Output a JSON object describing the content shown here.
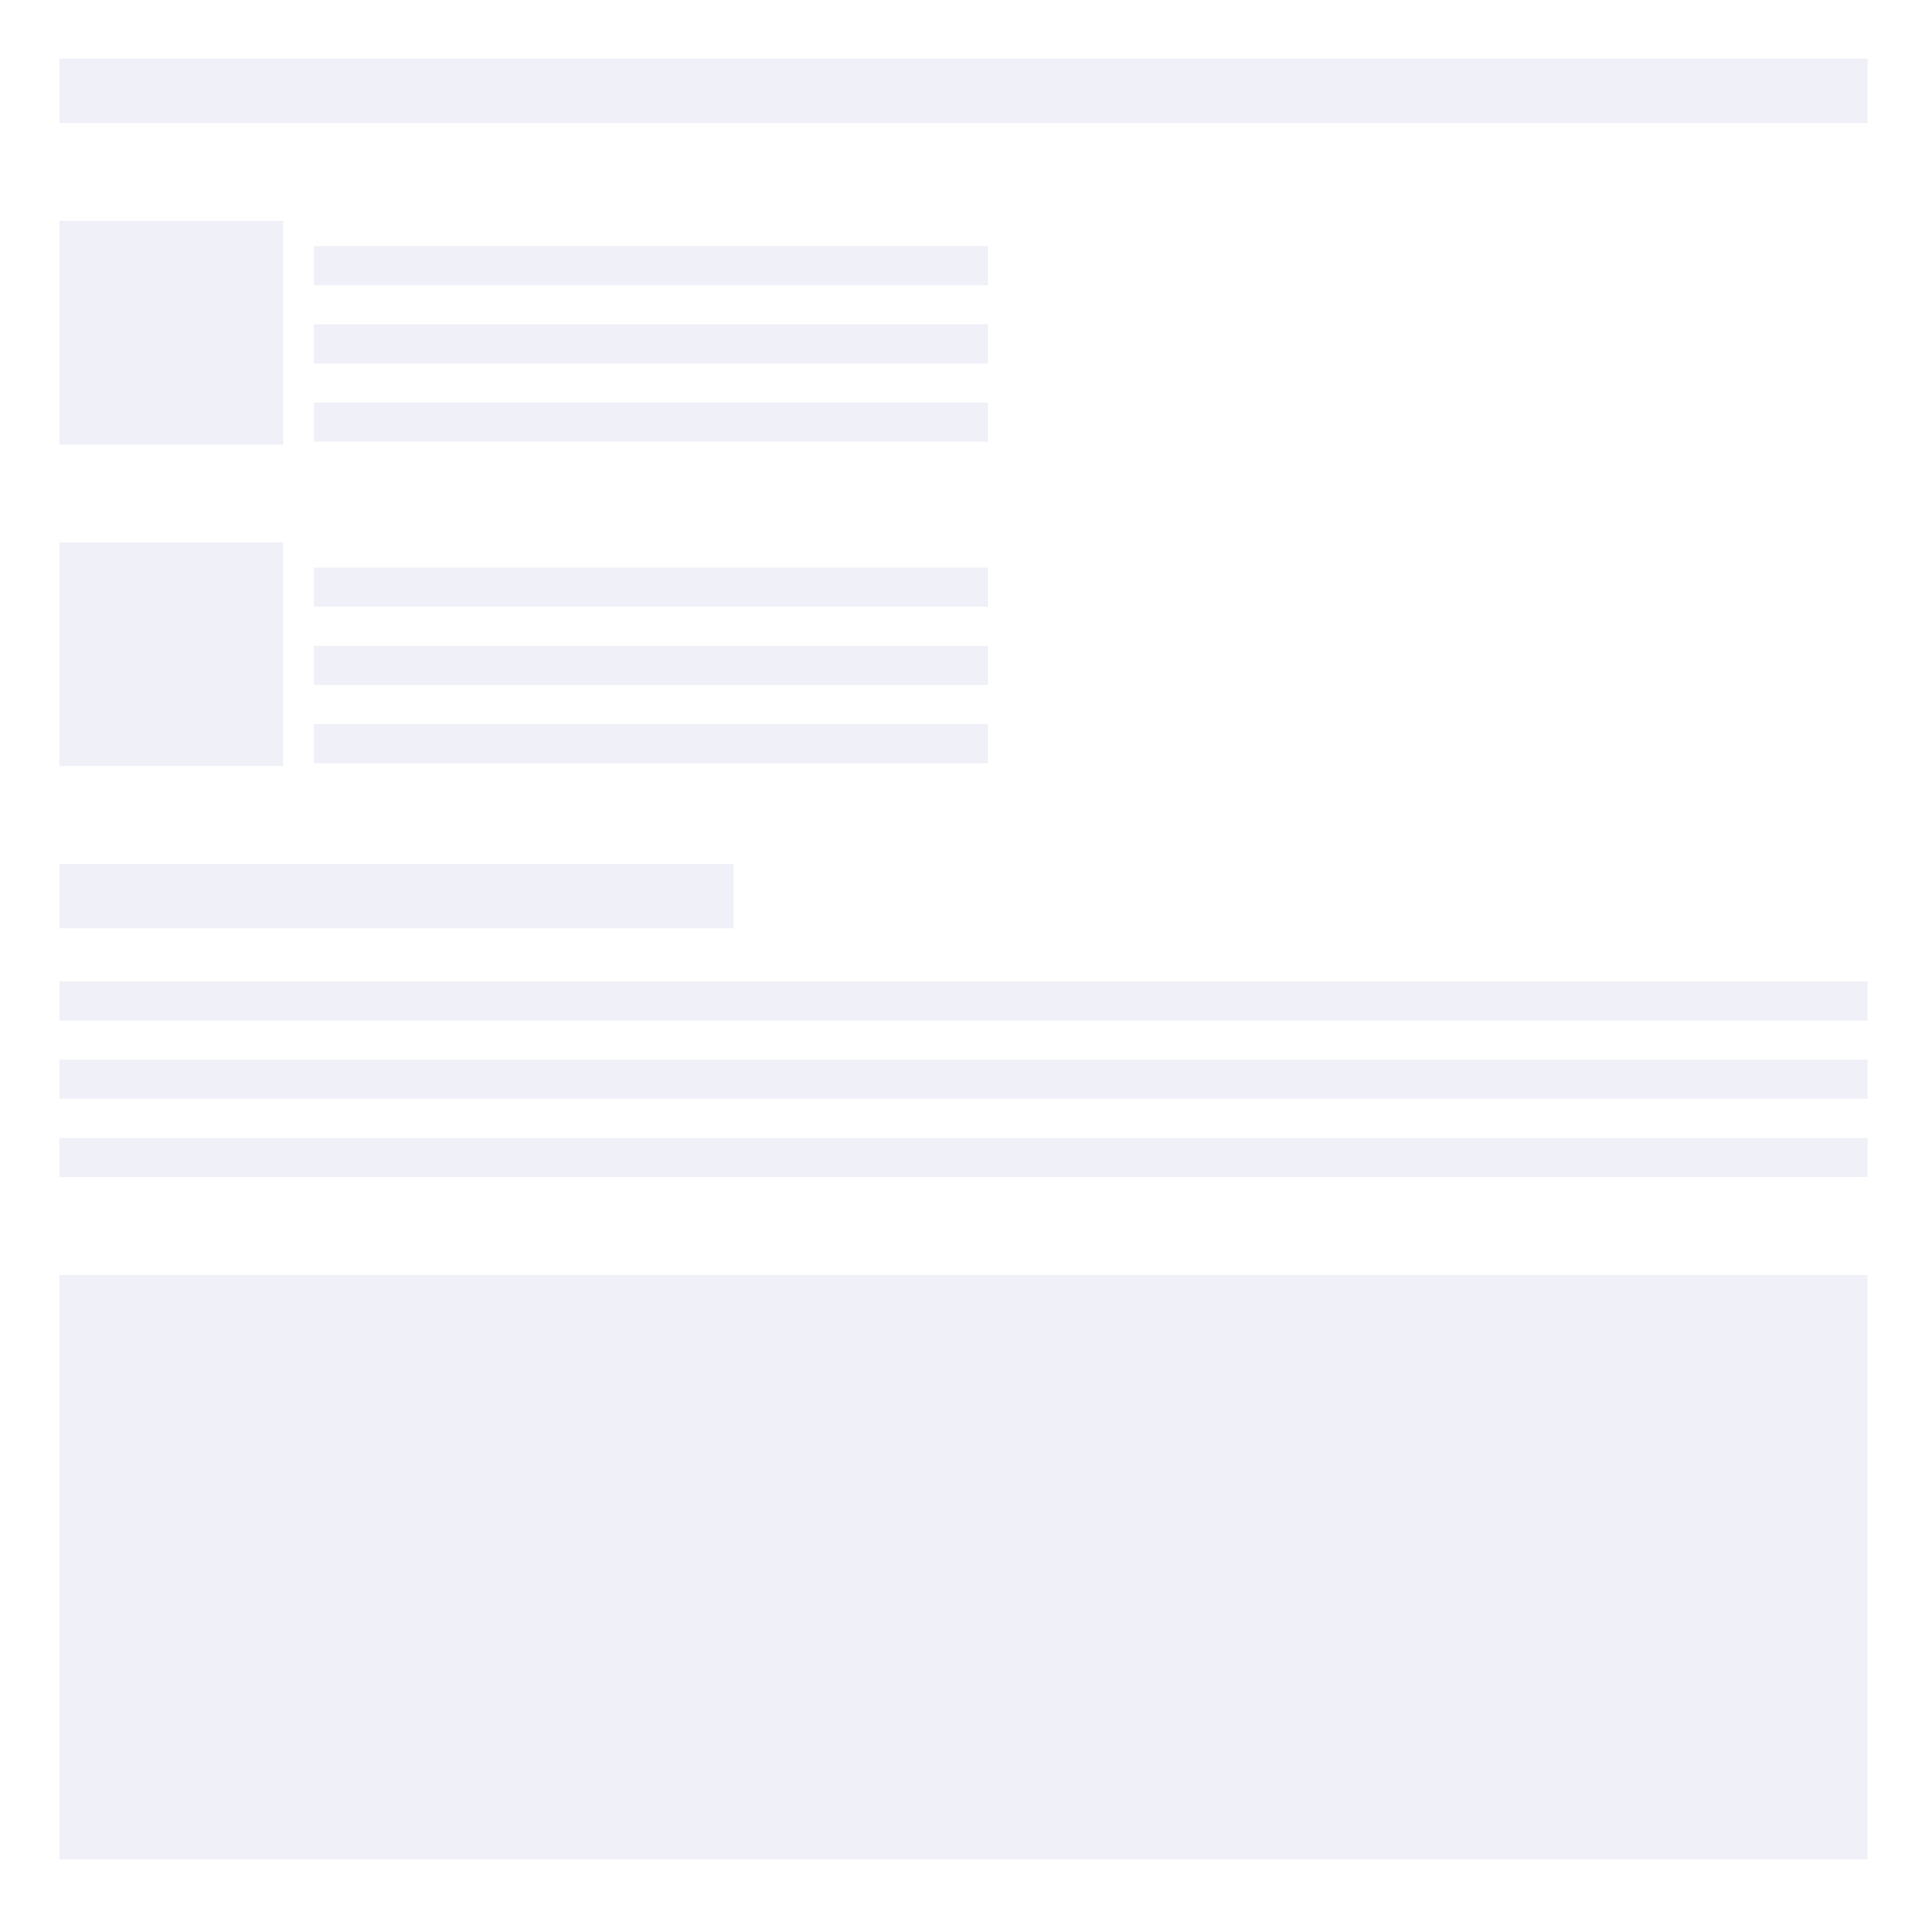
{
  "palette": {
    "background": "#ffffff",
    "placeholder": "#f0f0f8"
  },
  "skeleton": {
    "state": "loading",
    "header": {},
    "media_rows": [
      {
        "lines": 3
      },
      {
        "lines": 3
      }
    ],
    "section": {
      "full_lines": 3
    },
    "content_block": {}
  }
}
